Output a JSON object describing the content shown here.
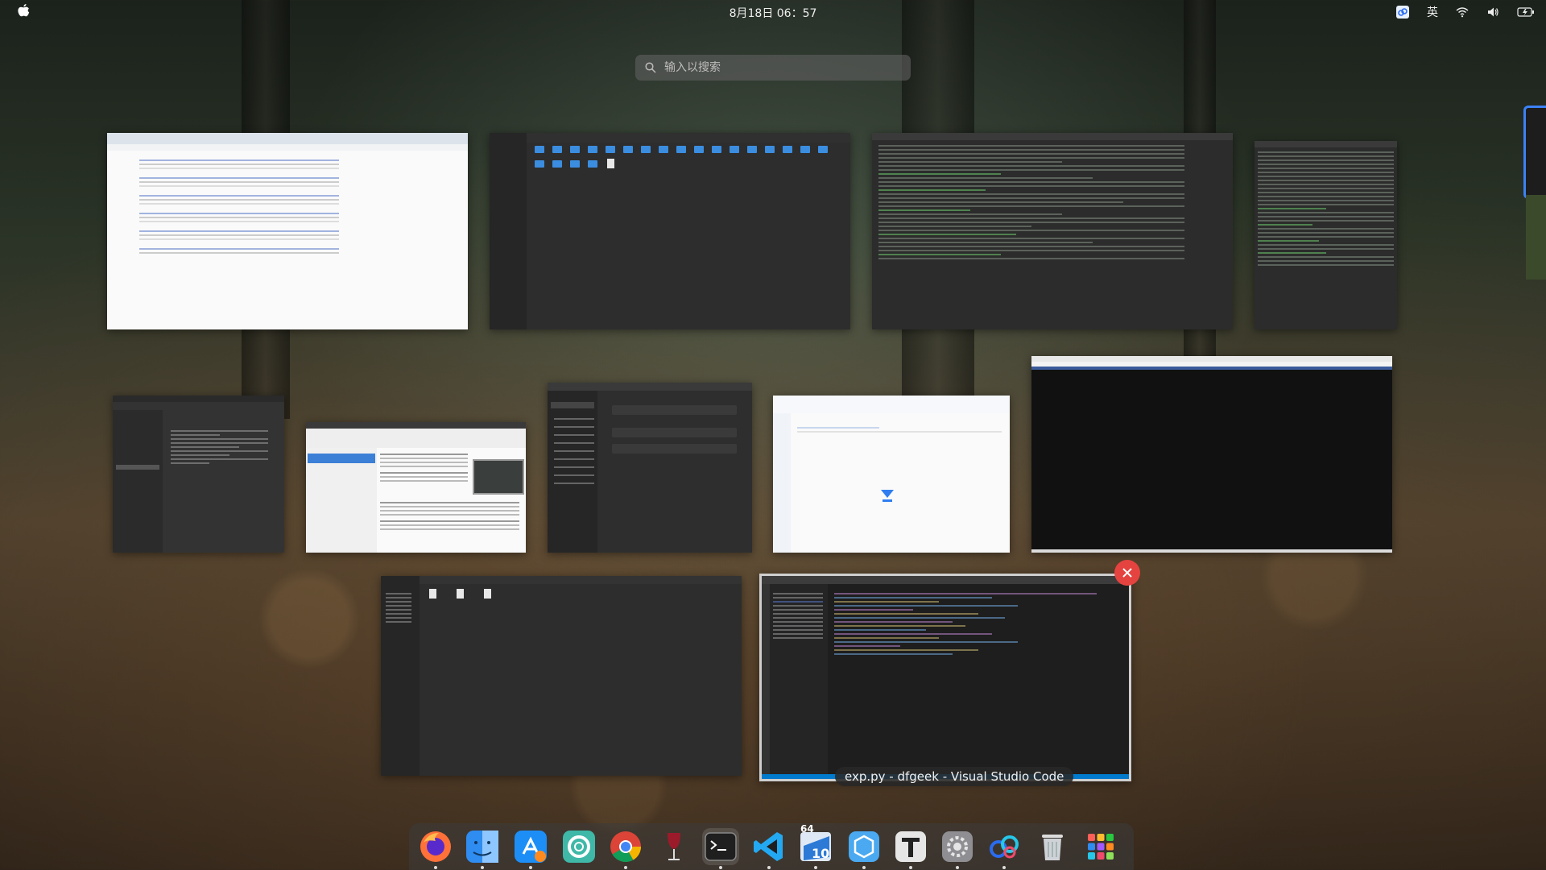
{
  "top_bar": {
    "clock": "8月18日 06：57",
    "ime_label": "英"
  },
  "search": {
    "placeholder": "输入以搜索"
  },
  "windows": [
    {
      "id": "browser",
      "kind": "browser-search-results"
    },
    {
      "id": "files-1",
      "kind": "file-manager"
    },
    {
      "id": "terminal-1",
      "kind": "terminal"
    },
    {
      "id": "terminal-2",
      "kind": "terminal"
    },
    {
      "id": "text-editor-prefs",
      "kind": "preferences-dialog"
    },
    {
      "id": "virtualbox",
      "kind": "virtualbox-manager"
    },
    {
      "id": "settings",
      "kind": "settings"
    },
    {
      "id": "baidu-netdisk",
      "kind": "netdisk-client"
    },
    {
      "id": "black-window",
      "kind": "blank-window"
    },
    {
      "id": "files-2",
      "kind": "file-manager"
    },
    {
      "id": "vscode",
      "kind": "code-editor",
      "selected": true
    }
  ],
  "hover_tooltip": "exp.py - dfgeek - Visual Studio Code",
  "dock": {
    "items": [
      {
        "name": "firefox",
        "running": true
      },
      {
        "name": "finder",
        "running": true
      },
      {
        "name": "app-store",
        "running": true
      },
      {
        "name": "help-center",
        "running": false
      },
      {
        "name": "chrome",
        "running": true
      },
      {
        "name": "wine",
        "running": false
      },
      {
        "name": "terminal",
        "running": true
      },
      {
        "name": "vscode",
        "running": true
      },
      {
        "name": "win64-10",
        "running": true,
        "badge": "64",
        "badge2": "10"
      },
      {
        "name": "virtual-machine",
        "running": true
      },
      {
        "name": "typora",
        "running": true
      },
      {
        "name": "system-settings",
        "running": true
      },
      {
        "name": "baidu-netdisk",
        "running": true
      },
      {
        "name": "trash",
        "running": false
      },
      {
        "name": "app-grid",
        "running": false
      }
    ]
  },
  "colors": {
    "accent": "#3b82f6",
    "close": "#e5433f"
  }
}
